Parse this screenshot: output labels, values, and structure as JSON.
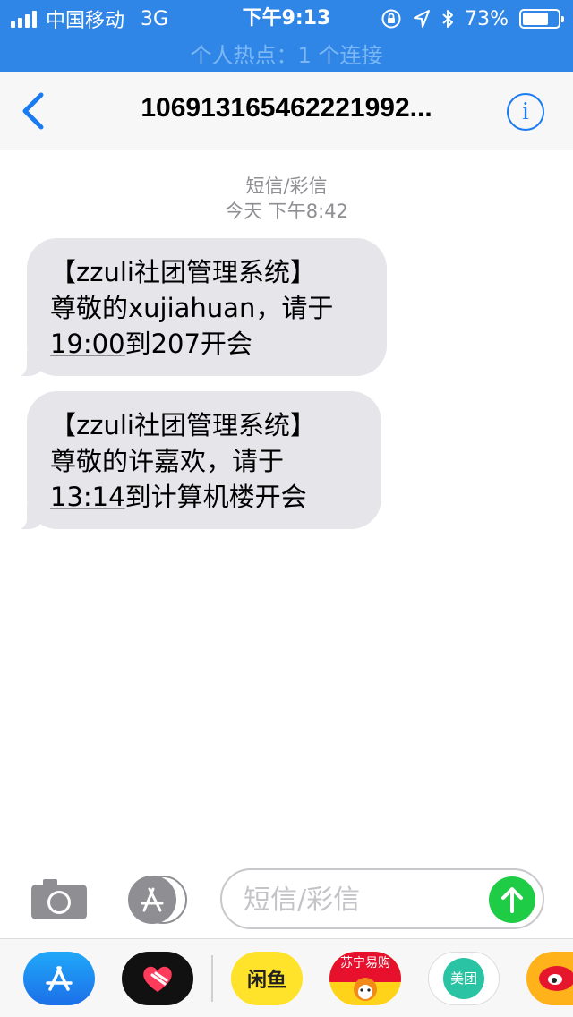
{
  "status_bar": {
    "carrier": "中国移动",
    "network": "3G",
    "time": "下午9:13",
    "battery_text": "73%",
    "battery_level": 0.73,
    "hotspot_text": "个人热点：1 个连接"
  },
  "nav": {
    "title": "106913165462221992..."
  },
  "conversation": {
    "type_label": "短信/彩信",
    "timestamp": "今天 下午8:42",
    "messages": [
      {
        "line1": "【zzuli社团管理系统】",
        "line2": "尊敬的xujiahuan，请于",
        "time": "19:00",
        "rest": "到207开会"
      },
      {
        "line1": "【zzuli社团管理系统】",
        "line2": "尊敬的许嘉欢，请于",
        "time": "13:14",
        "rest": "到计算机楼开会"
      }
    ]
  },
  "input": {
    "placeholder": "短信/彩信"
  },
  "app_drawer": {
    "xianyu_label": "闲鱼",
    "suning_label": "苏宁易购",
    "meituan_label": "美团"
  },
  "colors": {
    "status_bar": "#2f86e6",
    "accent": "#1a7cf0",
    "bubble": "#e5e5ea",
    "send": "#1fcc45"
  }
}
